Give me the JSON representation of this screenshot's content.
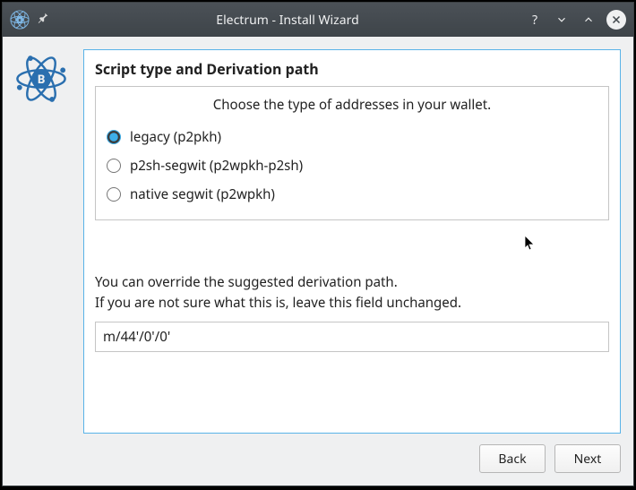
{
  "window": {
    "title": "Electrum  -  Install Wizard"
  },
  "section": {
    "title": "Script type and Derivation path",
    "caption": "Choose the type of addresses in your wallet."
  },
  "options": [
    {
      "label": "legacy (p2pkh)",
      "selected": true
    },
    {
      "label": "p2sh-segwit (p2wpkh-p2sh)",
      "selected": false
    },
    {
      "label": "native segwit (p2wpkh)",
      "selected": false
    }
  ],
  "hint": {
    "line1": "You can override the suggested derivation path.",
    "line2": "If you are not sure what this is, leave this field unchanged."
  },
  "derivation_path": {
    "value": "m/44'/0'/0'"
  },
  "buttons": {
    "back": "Back",
    "next": "Next"
  }
}
